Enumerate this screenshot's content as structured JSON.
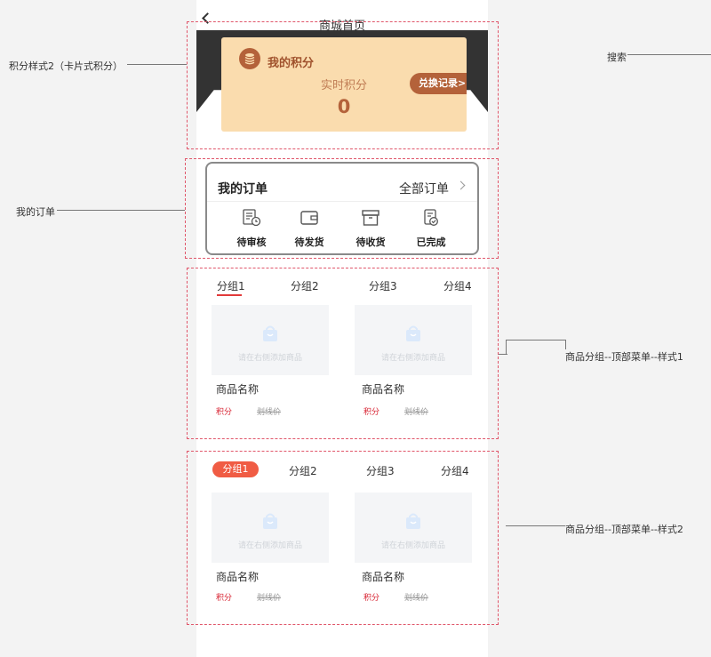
{
  "nav": {
    "title": "商城首页"
  },
  "points_card": {
    "title": "我的积分",
    "subtitle": "实时积分",
    "value": "0",
    "exchange_label": "兑换记录>"
  },
  "order_card": {
    "title": "我的订单",
    "all_label": "全部订单",
    "items": [
      {
        "label": "待审核",
        "icon": "audit-pending-icon"
      },
      {
        "label": "待发货",
        "icon": "wallet-icon"
      },
      {
        "label": "待收货",
        "icon": "box-icon"
      },
      {
        "label": "已完成",
        "icon": "completed-doc-icon"
      }
    ]
  },
  "group_style1": {
    "tabs": [
      "分组1",
      "分组2",
      "分组3",
      "分组4"
    ],
    "active_tab": 0,
    "products": [
      {
        "placeholder": "请在右侧添加商品",
        "name": "商品名称",
        "points": "积分",
        "strike_price": "划线价"
      },
      {
        "placeholder": "请在右侧添加商品",
        "name": "商品名称",
        "points": "积分",
        "strike_price": "划线价"
      }
    ]
  },
  "group_style2": {
    "tabs": [
      "分组1",
      "分组2",
      "分组3",
      "分组4"
    ],
    "active_tab": 0,
    "products": [
      {
        "placeholder": "请在右侧添加商品",
        "name": "商品名称",
        "points": "积分",
        "strike_price": "划线价"
      },
      {
        "placeholder": "请在右侧添加商品",
        "name": "商品名称",
        "points": "积分",
        "strike_price": "划线价"
      }
    ]
  },
  "annotations": {
    "points_style": "积分样式2（卡片式积分）",
    "search": "搜索",
    "my_orders": "我的订单",
    "group_style1": "商品分组--顶部菜单--样式1",
    "group_style2": "商品分组--顶部菜单--样式2"
  },
  "colors": {
    "accent_red": "#e23a3a",
    "pill_red": "#f05c44",
    "points_card_bg": "#fadcae",
    "points_brown": "#b4623a",
    "dark_header": "#333333"
  }
}
